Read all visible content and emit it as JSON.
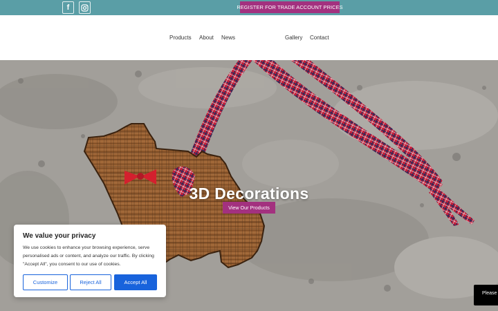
{
  "topbar": {
    "facebook_icon": "facebook-icon",
    "instagram_icon": "instagram-icon",
    "trade_button": "REGISTER FOR TRADE ACCOUNT PRICES"
  },
  "nav": {
    "items": [
      "Products",
      "About",
      "News",
      "Gallery",
      "Contact"
    ]
  },
  "hero": {
    "title": "3D Decorations",
    "button": "View Our Products"
  },
  "cookie": {
    "title": "We value your privacy",
    "text": "We use cookies to enhance your browsing experience, serve personalised ads or content, and analyze our traffic. By clicking \"Accept All\", you consent to our use of cookies.",
    "customize": "Customize",
    "reject": "Reject All",
    "accept": "Accept All"
  },
  "corner_box": {
    "text": "Please"
  },
  "colors": {
    "topbar": "#5a9ea6",
    "accent": "#a3317f",
    "cookie_blue": "#1863dc"
  }
}
